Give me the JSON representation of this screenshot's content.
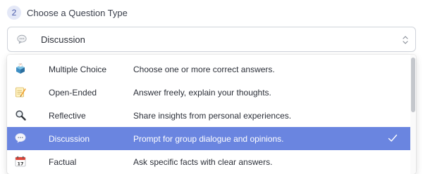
{
  "step": {
    "number": "2",
    "title": "Choose a Question Type"
  },
  "select": {
    "value": "Discussion",
    "icon": "speech-bubble-icon"
  },
  "options": [
    {
      "label": "Multiple Choice",
      "description": "Choose one or more correct answers.",
      "icon": "ballot-box-icon",
      "selected": false
    },
    {
      "label": "Open-Ended",
      "description": "Answer freely, explain your thoughts.",
      "icon": "memo-icon",
      "selected": false
    },
    {
      "label": "Reflective",
      "description": "Share insights from personal experiences.",
      "icon": "magnifier-icon",
      "selected": false
    },
    {
      "label": "Discussion",
      "description": "Prompt for group dialogue and opinions.",
      "icon": "speech-bubble-icon",
      "selected": true
    },
    {
      "label": "Factual",
      "description": "Ask specific facts with clear answers.",
      "icon": "calendar-icon",
      "selected": false
    }
  ],
  "calendar_day": "17",
  "colors": {
    "accent": "#6a85e0",
    "badge_bg": "#e4e8f7",
    "border": "#cfd3da"
  }
}
